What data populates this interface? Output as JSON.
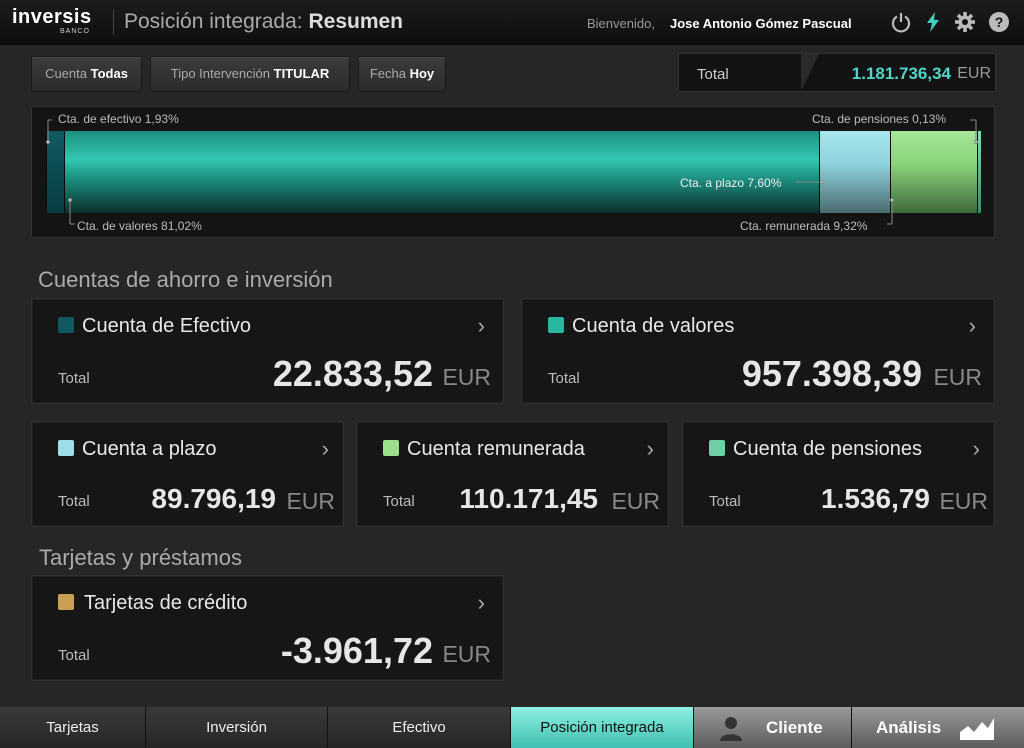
{
  "header": {
    "logo_text": "inversis",
    "logo_sub": "BANCO",
    "title_prefix": "Posición integrada:",
    "title_main": "Resumen",
    "welcome": "Bienvenido,",
    "user": "Jose Antonio Gómez Pascual",
    "icons": [
      "power-icon",
      "lightning-icon",
      "gear-icon",
      "help-icon"
    ]
  },
  "filters": [
    {
      "label": "Cuenta",
      "value": "Todas"
    },
    {
      "label": "Tipo Intervención",
      "value": "TITULAR"
    },
    {
      "label": "Fecha",
      "value": "Hoy"
    }
  ],
  "total": {
    "label": "Total",
    "value": "1.181.736,34",
    "currency": "EUR"
  },
  "chart_data": {
    "type": "bar",
    "orientation": "horizontal-stacked",
    "categories": [
      "Cta. de efectivo",
      "Cta. de valores",
      "Cta. a plazo",
      "Cta. remunerada",
      "Cta. de pensiones"
    ],
    "values": [
      1.93,
      81.02,
      7.6,
      9.32,
      0.13
    ],
    "labels": [
      "Cta. de efectivo 1,93%",
      "Cta. de valores 81,02%",
      "Cta. a plazo 7,60%",
      "Cta. remunerada 9,32%",
      "Cta. de pensiones 0,13%"
    ],
    "colors": [
      "#0f5a60",
      "#2ab7a0",
      "#9fdde6",
      "#9ce08e",
      "#6fd0a8"
    ]
  },
  "sections": {
    "savings": "Cuentas de ahorro e inversión",
    "cards": "Tarjetas y préstamos"
  },
  "accounts": [
    {
      "name": "Cuenta de Efectivo",
      "total_label": "Total",
      "amount": "22.833,52",
      "currency": "EUR",
      "color": "#0f5a60"
    },
    {
      "name": "Cuenta de valores",
      "total_label": "Total",
      "amount": "957.398,39",
      "currency": "EUR",
      "color": "#2ab7a0"
    },
    {
      "name": "Cuenta a plazo",
      "total_label": "Total",
      "amount": "89.796,19",
      "currency": "EUR",
      "color": "#9fdde6"
    },
    {
      "name": "Cuenta remunerada",
      "total_label": "Total",
      "amount": "110.171,45",
      "currency": "EUR",
      "color": "#9ce08e"
    },
    {
      "name": "Cuenta de pensiones",
      "total_label": "Total",
      "amount": "1.536,79",
      "currency": "EUR",
      "color": "#6fd0a8"
    }
  ],
  "credit": {
    "name": "Tarjetas de crédito",
    "total_label": "Total",
    "amount": "-3.961,72",
    "currency": "EUR",
    "color": "#c8a050"
  },
  "tabs": [
    "Tarjetas",
    "Inversión",
    "Efectivo",
    "Posición integrada",
    "Cliente",
    "Análisis"
  ]
}
